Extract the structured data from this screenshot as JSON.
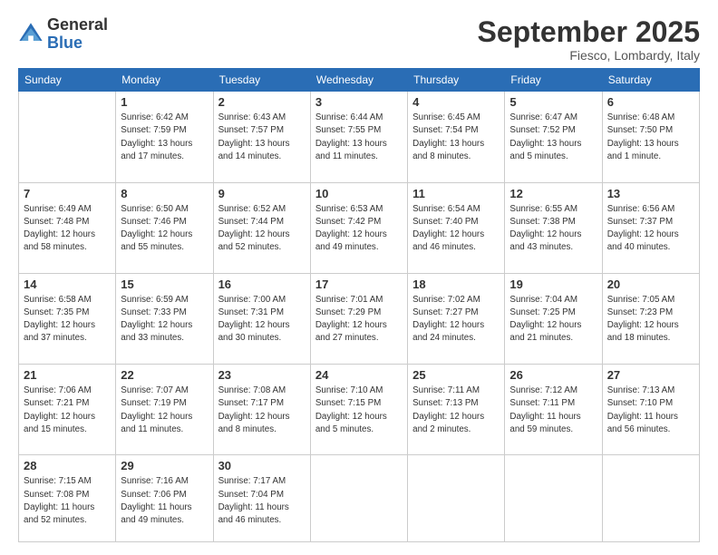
{
  "logo": {
    "general": "General",
    "blue": "Blue"
  },
  "header": {
    "month": "September 2025",
    "location": "Fiesco, Lombardy, Italy"
  },
  "weekdays": [
    "Sunday",
    "Monday",
    "Tuesday",
    "Wednesday",
    "Thursday",
    "Friday",
    "Saturday"
  ],
  "weeks": [
    [
      {
        "day": "",
        "info": ""
      },
      {
        "day": "1",
        "info": "Sunrise: 6:42 AM\nSunset: 7:59 PM\nDaylight: 13 hours\nand 17 minutes."
      },
      {
        "day": "2",
        "info": "Sunrise: 6:43 AM\nSunset: 7:57 PM\nDaylight: 13 hours\nand 14 minutes."
      },
      {
        "day": "3",
        "info": "Sunrise: 6:44 AM\nSunset: 7:55 PM\nDaylight: 13 hours\nand 11 minutes."
      },
      {
        "day": "4",
        "info": "Sunrise: 6:45 AM\nSunset: 7:54 PM\nDaylight: 13 hours\nand 8 minutes."
      },
      {
        "day": "5",
        "info": "Sunrise: 6:47 AM\nSunset: 7:52 PM\nDaylight: 13 hours\nand 5 minutes."
      },
      {
        "day": "6",
        "info": "Sunrise: 6:48 AM\nSunset: 7:50 PM\nDaylight: 13 hours\nand 1 minute."
      }
    ],
    [
      {
        "day": "7",
        "info": "Sunrise: 6:49 AM\nSunset: 7:48 PM\nDaylight: 12 hours\nand 58 minutes."
      },
      {
        "day": "8",
        "info": "Sunrise: 6:50 AM\nSunset: 7:46 PM\nDaylight: 12 hours\nand 55 minutes."
      },
      {
        "day": "9",
        "info": "Sunrise: 6:52 AM\nSunset: 7:44 PM\nDaylight: 12 hours\nand 52 minutes."
      },
      {
        "day": "10",
        "info": "Sunrise: 6:53 AM\nSunset: 7:42 PM\nDaylight: 12 hours\nand 49 minutes."
      },
      {
        "day": "11",
        "info": "Sunrise: 6:54 AM\nSunset: 7:40 PM\nDaylight: 12 hours\nand 46 minutes."
      },
      {
        "day": "12",
        "info": "Sunrise: 6:55 AM\nSunset: 7:38 PM\nDaylight: 12 hours\nand 43 minutes."
      },
      {
        "day": "13",
        "info": "Sunrise: 6:56 AM\nSunset: 7:37 PM\nDaylight: 12 hours\nand 40 minutes."
      }
    ],
    [
      {
        "day": "14",
        "info": "Sunrise: 6:58 AM\nSunset: 7:35 PM\nDaylight: 12 hours\nand 37 minutes."
      },
      {
        "day": "15",
        "info": "Sunrise: 6:59 AM\nSunset: 7:33 PM\nDaylight: 12 hours\nand 33 minutes."
      },
      {
        "day": "16",
        "info": "Sunrise: 7:00 AM\nSunset: 7:31 PM\nDaylight: 12 hours\nand 30 minutes."
      },
      {
        "day": "17",
        "info": "Sunrise: 7:01 AM\nSunset: 7:29 PM\nDaylight: 12 hours\nand 27 minutes."
      },
      {
        "day": "18",
        "info": "Sunrise: 7:02 AM\nSunset: 7:27 PM\nDaylight: 12 hours\nand 24 minutes."
      },
      {
        "day": "19",
        "info": "Sunrise: 7:04 AM\nSunset: 7:25 PM\nDaylight: 12 hours\nand 21 minutes."
      },
      {
        "day": "20",
        "info": "Sunrise: 7:05 AM\nSunset: 7:23 PM\nDaylight: 12 hours\nand 18 minutes."
      }
    ],
    [
      {
        "day": "21",
        "info": "Sunrise: 7:06 AM\nSunset: 7:21 PM\nDaylight: 12 hours\nand 15 minutes."
      },
      {
        "day": "22",
        "info": "Sunrise: 7:07 AM\nSunset: 7:19 PM\nDaylight: 12 hours\nand 11 minutes."
      },
      {
        "day": "23",
        "info": "Sunrise: 7:08 AM\nSunset: 7:17 PM\nDaylight: 12 hours\nand 8 minutes."
      },
      {
        "day": "24",
        "info": "Sunrise: 7:10 AM\nSunset: 7:15 PM\nDaylight: 12 hours\nand 5 minutes."
      },
      {
        "day": "25",
        "info": "Sunrise: 7:11 AM\nSunset: 7:13 PM\nDaylight: 12 hours\nand 2 minutes."
      },
      {
        "day": "26",
        "info": "Sunrise: 7:12 AM\nSunset: 7:11 PM\nDaylight: 11 hours\nand 59 minutes."
      },
      {
        "day": "27",
        "info": "Sunrise: 7:13 AM\nSunset: 7:10 PM\nDaylight: 11 hours\nand 56 minutes."
      }
    ],
    [
      {
        "day": "28",
        "info": "Sunrise: 7:15 AM\nSunset: 7:08 PM\nDaylight: 11 hours\nand 52 minutes."
      },
      {
        "day": "29",
        "info": "Sunrise: 7:16 AM\nSunset: 7:06 PM\nDaylight: 11 hours\nand 49 minutes."
      },
      {
        "day": "30",
        "info": "Sunrise: 7:17 AM\nSunset: 7:04 PM\nDaylight: 11 hours\nand 46 minutes."
      },
      {
        "day": "",
        "info": ""
      },
      {
        "day": "",
        "info": ""
      },
      {
        "day": "",
        "info": ""
      },
      {
        "day": "",
        "info": ""
      }
    ]
  ]
}
